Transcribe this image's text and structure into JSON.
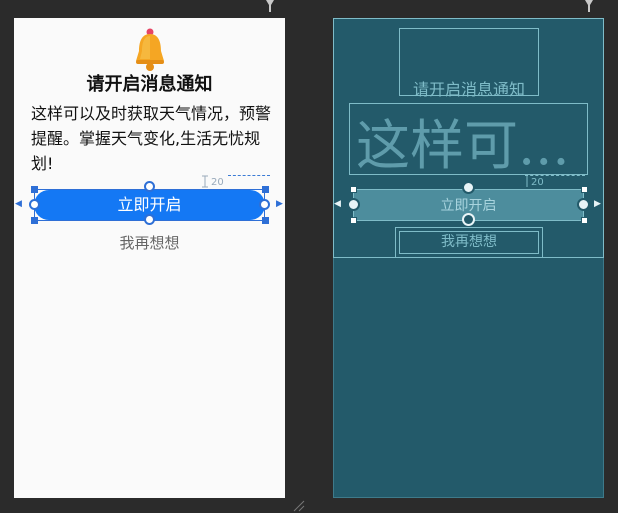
{
  "design": {
    "bell_icon": "bell-icon",
    "title": "请开启消息通知",
    "body": "这样可以及时获取天气情况，预警提醒。掌握天气变化,生活无忧规划!",
    "primary_button": "立即开启",
    "secondary_button": "我再想想",
    "margin_hint": "20",
    "colors": {
      "primary": "#1478f4",
      "surface": "#fafafa",
      "selection": "#2e6fd6"
    }
  },
  "blueprint": {
    "title": "请开启消息通知",
    "body_preview": "这样可...",
    "primary_button": "立即开启",
    "secondary_button": "我再想想",
    "margin_hint": "20",
    "colors": {
      "surface": "#235a6a",
      "outline": "#7fbcc8"
    }
  },
  "editor": {
    "background": "#2b2b2b"
  }
}
